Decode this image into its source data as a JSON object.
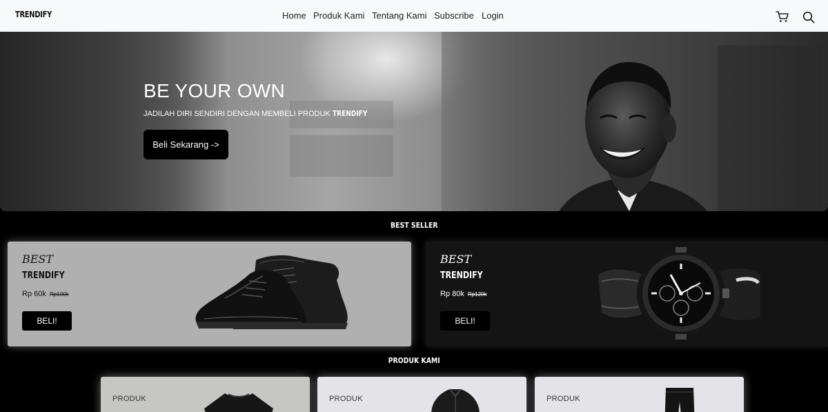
{
  "navbar": {
    "brand": "TRENDIFY",
    "links": [
      "Home",
      "Produk Kami",
      "Tentang Kami",
      "Subscribe",
      "Login"
    ],
    "icons": [
      "cart-icon",
      "search-icon"
    ]
  },
  "hero": {
    "title": "BE YOUR OWN",
    "subtitle_prefix": "JADILAH DIRI SENDIRI DENGAN MEMBELI PRODUK ",
    "subtitle_brand": "TRENDIFY",
    "cta": "Beli Sekarang ->"
  },
  "best_seller": {
    "title": "BEST SELLER",
    "items": [
      {
        "tag": "BEST",
        "name": "TRENDIFY",
        "price": "Rp 60k",
        "old_price": "Rp100k",
        "buy": "BELI!",
        "image": "black sneakers"
      },
      {
        "tag": "BEST",
        "name": "TRENDIFY",
        "price": "Rp 80k",
        "old_price": "Rp120k",
        "buy": "BELI!",
        "image": "black chronograph watch"
      }
    ]
  },
  "products": {
    "title": "PRODUK KAMI",
    "items": [
      {
        "label": "PRODUK",
        "image": "black t-shirt"
      },
      {
        "label": "PRODUK",
        "image": "black jacket"
      },
      {
        "label": "PRODUK",
        "image": "black pants"
      }
    ]
  },
  "colors": {
    "navbar": "#f8f9fa",
    "background": "#000000",
    "card_light": "#b0b0b0",
    "card_dark": "#141414"
  }
}
